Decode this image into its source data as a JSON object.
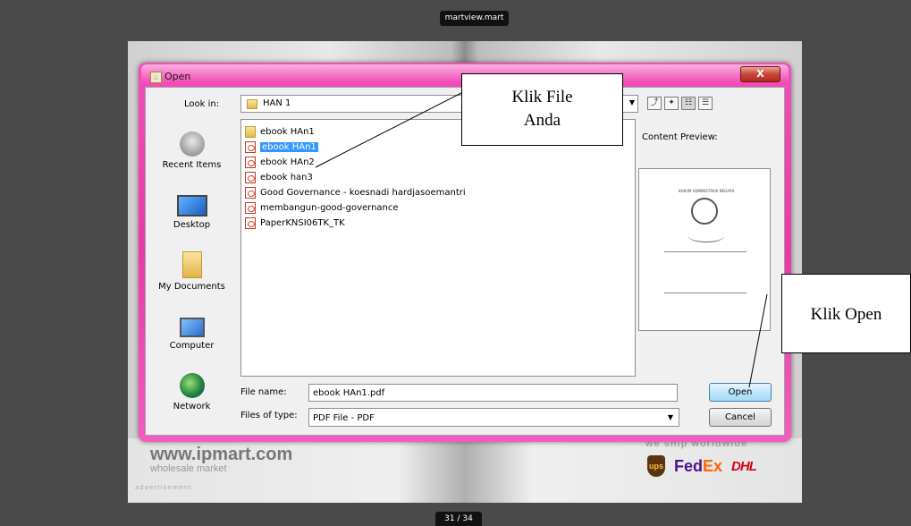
{
  "viewer": {
    "title": "martview.mart",
    "page_counter": "31 / 34"
  },
  "advert": {
    "url": "www.ipmart.com",
    "subtitle": "wholesale market",
    "label": "advertisement",
    "shipping": "we ship worldwide",
    "logos": {
      "ups": "ups",
      "fedex_fed": "Fed",
      "fedex_ex": "Ex",
      "dhl": "DHL"
    }
  },
  "dialog": {
    "title": "Open",
    "close_label": "X",
    "look_in_label": "Look in:",
    "look_in_value": "HAN 1",
    "places": [
      {
        "label": "Recent Items",
        "icon": "recent-items-icon"
      },
      {
        "label": "Desktop",
        "icon": "desktop-icon"
      },
      {
        "label": "My Documents",
        "icon": "my-documents-icon"
      },
      {
        "label": "Computer",
        "icon": "computer-icon"
      },
      {
        "label": "Network",
        "icon": "network-icon"
      }
    ],
    "files": [
      {
        "name": "ebook HAn1",
        "type": "folder"
      },
      {
        "name": "ebook HAn1",
        "type": "pdf",
        "selected": true
      },
      {
        "name": "ebook HAn2",
        "type": "pdf"
      },
      {
        "name": "ebook han3",
        "type": "pdf"
      },
      {
        "name": "Good Governance - koesnadi hardjasoemantri",
        "type": "pdf"
      },
      {
        "name": "membangun-good-governance",
        "type": "pdf"
      },
      {
        "name": "PaperKNSI06TK_TK",
        "type": "pdf"
      }
    ],
    "preview_label": "Content Preview:",
    "preview_doc_title": "HUKUM ADMINISTRASI NEGARA",
    "file_name_label": "File name:",
    "file_name_value": "ebook HAn1.pdf",
    "file_type_label": "Files of type:",
    "file_type_value": "PDF File - PDF",
    "open_button": "Open",
    "cancel_button": "Cancel"
  },
  "annotations": {
    "callout_file_line1": "Klik File",
    "callout_file_line2": "Anda",
    "callout_open": "Klik Open"
  },
  "colors": {
    "frame_pink": "#e73aa8",
    "selection_blue": "#3399ff",
    "close_red": "#c9473a"
  }
}
